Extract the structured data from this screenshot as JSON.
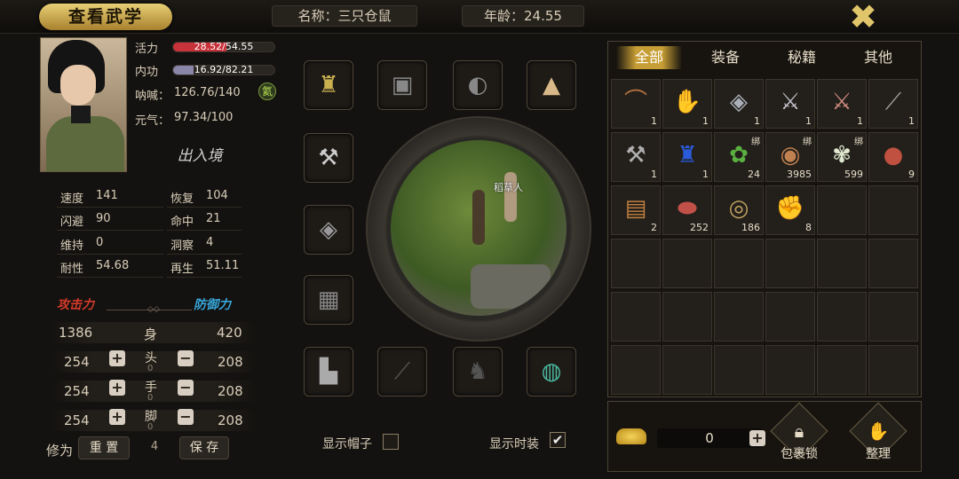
{
  "header": {
    "title": "查看武学",
    "name_text": "名称：三只仓鼠",
    "age_text": "年龄：24.55"
  },
  "character": {
    "bars": [
      {
        "label": "活力",
        "value_text": "28.52/54.55",
        "fill": 0.523,
        "color": "#c8323a"
      },
      {
        "label": "内功",
        "value_text": "16.92/82.21",
        "fill": 0.206,
        "color": "#8a86a8"
      }
    ],
    "shout_label": "呐喊：",
    "shout_value": "126.76/140",
    "vital_label": "元气：",
    "vital_value": "97.34/100",
    "badge_text": "氦",
    "realm_text": "出入境"
  },
  "attributes": [
    {
      "l1": "速度",
      "v1": "141",
      "l2": "恢复",
      "v2": "104"
    },
    {
      "l1": "闪避",
      "v1": "90",
      "l2": "命中",
      "v2": "21"
    },
    {
      "l1": "维持",
      "v1": "0",
      "l2": "洞察",
      "v2": "4"
    },
    {
      "l1": "耐性",
      "v1": "54.68",
      "l2": "再生",
      "v2": "51.11"
    }
  ],
  "combat": {
    "attack_label": "攻击力",
    "defense_label": "防御力",
    "body": {
      "label": "身",
      "attack": "1386",
      "defense": "420"
    },
    "parts": [
      {
        "label": "头",
        "attack": "254",
        "sub": "0",
        "defense": "208"
      },
      {
        "label": "手",
        "attack": "254",
        "sub": "0",
        "defense": "208"
      },
      {
        "label": "脚",
        "attack": "254",
        "sub": "0",
        "defense": "208"
      }
    ],
    "cultivation_label": "修为",
    "reset_label": "重 置",
    "points": "4",
    "save_label": "保 存"
  },
  "equipment": {
    "map_label": "稻草人",
    "show_hat_label": "显示帽子",
    "show_fashion_label": "显示时装"
  },
  "inventory": {
    "tabs": [
      "全部",
      "装备",
      "秘籍",
      "其他"
    ],
    "active_tab": 0,
    "items": [
      {
        "icon": "bow-icon",
        "glyph": "⌒",
        "count": "1",
        "bind": ""
      },
      {
        "icon": "gauntlet-icon",
        "glyph": "✋",
        "count": "1",
        "bind": ""
      },
      {
        "icon": "bracer-icon",
        "glyph": "◈",
        "count": "1",
        "bind": ""
      },
      {
        "icon": "sword-icon",
        "glyph": "⚔",
        "count": "1",
        "bind": ""
      },
      {
        "icon": "sabre-icon",
        "glyph": "⚔",
        "count": "1",
        "bind": ""
      },
      {
        "icon": "spear-icon",
        "glyph": "⟋",
        "count": "1",
        "bind": ""
      },
      {
        "icon": "axe-icon",
        "glyph": "⚒",
        "count": "1",
        "bind": ""
      },
      {
        "icon": "blue-robe-icon",
        "glyph": "♜",
        "count": "1",
        "bind": ""
      },
      {
        "icon": "herb-icon",
        "glyph": "✿",
        "count": "24",
        "bind": "绑"
      },
      {
        "icon": "food-bowl-icon",
        "glyph": "◉",
        "count": "3985",
        "bind": "绑"
      },
      {
        "icon": "flower-icon",
        "glyph": "✾",
        "count": "599",
        "bind": "绑"
      },
      {
        "icon": "meat-icon",
        "glyph": "●",
        "count": "9",
        "bind": ""
      },
      {
        "icon": "scroll-icon",
        "glyph": "▤",
        "count": "2",
        "bind": ""
      },
      {
        "icon": "raw-meat-icon",
        "glyph": "⬬",
        "count": "252",
        "bind": ""
      },
      {
        "icon": "coin-icon",
        "glyph": "◎",
        "count": "186",
        "bind": ""
      },
      {
        "icon": "paw-icon",
        "glyph": "✊",
        "count": "8",
        "bind": ""
      }
    ],
    "total_cells": 36
  },
  "bottom": {
    "gold_value": "0",
    "lock_label": "包裹锁",
    "sort_label": "整理"
  },
  "colors": {
    "accent_gold": "#c79e35",
    "attack_red": "#d43a2a",
    "defense_blue": "#36a6d8"
  }
}
